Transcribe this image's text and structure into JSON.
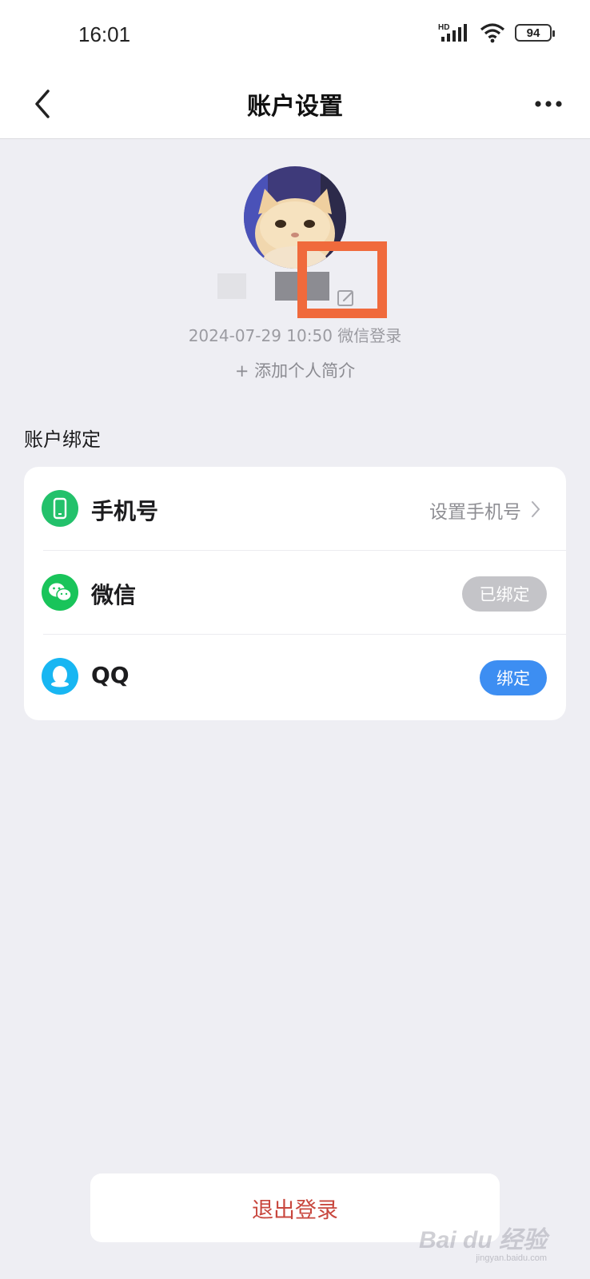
{
  "status_bar": {
    "time": "16:01",
    "network": "HD",
    "battery": "94"
  },
  "nav": {
    "title": "账户设置",
    "back_icon": "chevron-left-icon",
    "more_icon": "more-horizontal-icon"
  },
  "profile": {
    "avatar": "cat-avatar",
    "login_meta": "2024-07-29 10:50  微信登录",
    "add_bio": "+ 添加个人简介"
  },
  "bindings": {
    "section_title": "账户绑定",
    "rows": [
      {
        "label": "手机号",
        "icon": "phone-icon",
        "icon_color": "#23c16b",
        "value": "设置手机号"
      },
      {
        "label": "微信",
        "icon": "wechat-icon",
        "icon_color": "#19c45a",
        "badge": "已绑定",
        "badge_color": "#c4c4c8"
      },
      {
        "label": "QQ",
        "icon": "qq-icon",
        "icon_color": "#18b6f2",
        "badge": "绑定",
        "badge_color": "#3d8ef2"
      }
    ]
  },
  "logout": {
    "label": "退出登录",
    "color": "#c8473e"
  },
  "watermark": {
    "brand": "Bai du 经验",
    "url": "jingyan.baidu.com"
  },
  "highlight": {
    "color": "#f06a3c"
  }
}
